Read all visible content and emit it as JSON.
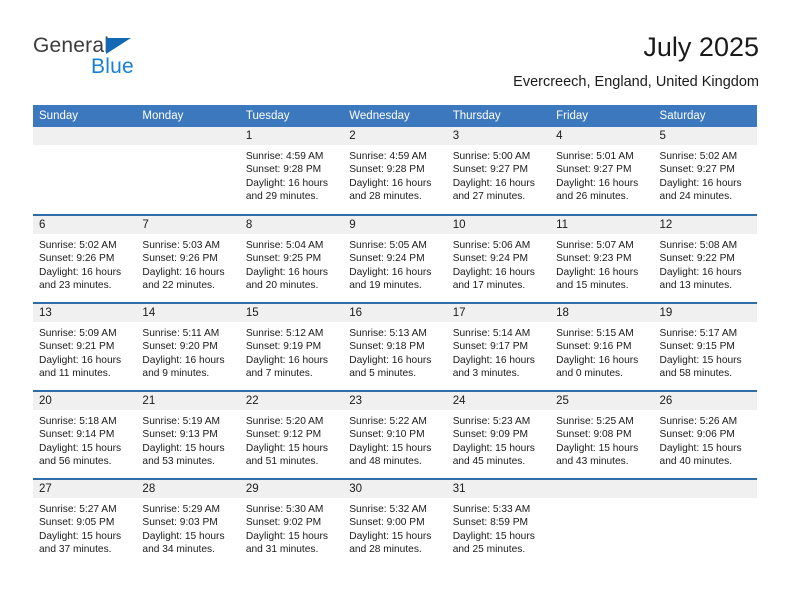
{
  "brand": {
    "name_top": "General",
    "name_bottom": "Blue",
    "triangle_color": "#1268b3",
    "blue_text_color": "#1a7fd4"
  },
  "header": {
    "title": "July 2025",
    "subtitle": "Evercreech, England, United Kingdom"
  },
  "colors": {
    "header_row_bg": "#3b78bd",
    "header_row_text": "#ffffff",
    "row_separator": "#2e6da8",
    "daynum_strip_bg": "#f0f0f0",
    "body_text": "#1a1a1a"
  },
  "weekday_headers": [
    "Sunday",
    "Monday",
    "Tuesday",
    "Wednesday",
    "Thursday",
    "Friday",
    "Saturday"
  ],
  "labels": {
    "sunrise_prefix": "Sunrise:",
    "sunset_prefix": "Sunset:",
    "daylight_prefix": "Daylight:"
  },
  "weeks": [
    [
      {
        "day": "",
        "sunrise": "",
        "sunset": "",
        "daylight_line1": "",
        "daylight_line2": ""
      },
      {
        "day": "",
        "sunrise": "",
        "sunset": "",
        "daylight_line1": "",
        "daylight_line2": ""
      },
      {
        "day": "1",
        "sunrise": "Sunrise: 4:59 AM",
        "sunset": "Sunset: 9:28 PM",
        "daylight_line1": "Daylight: 16 hours",
        "daylight_line2": "and 29 minutes."
      },
      {
        "day": "2",
        "sunrise": "Sunrise: 4:59 AM",
        "sunset": "Sunset: 9:28 PM",
        "daylight_line1": "Daylight: 16 hours",
        "daylight_line2": "and 28 minutes."
      },
      {
        "day": "3",
        "sunrise": "Sunrise: 5:00 AM",
        "sunset": "Sunset: 9:27 PM",
        "daylight_line1": "Daylight: 16 hours",
        "daylight_line2": "and 27 minutes."
      },
      {
        "day": "4",
        "sunrise": "Sunrise: 5:01 AM",
        "sunset": "Sunset: 9:27 PM",
        "daylight_line1": "Daylight: 16 hours",
        "daylight_line2": "and 26 minutes."
      },
      {
        "day": "5",
        "sunrise": "Sunrise: 5:02 AM",
        "sunset": "Sunset: 9:27 PM",
        "daylight_line1": "Daylight: 16 hours",
        "daylight_line2": "and 24 minutes."
      }
    ],
    [
      {
        "day": "6",
        "sunrise": "Sunrise: 5:02 AM",
        "sunset": "Sunset: 9:26 PM",
        "daylight_line1": "Daylight: 16 hours",
        "daylight_line2": "and 23 minutes."
      },
      {
        "day": "7",
        "sunrise": "Sunrise: 5:03 AM",
        "sunset": "Sunset: 9:26 PM",
        "daylight_line1": "Daylight: 16 hours",
        "daylight_line2": "and 22 minutes."
      },
      {
        "day": "8",
        "sunrise": "Sunrise: 5:04 AM",
        "sunset": "Sunset: 9:25 PM",
        "daylight_line1": "Daylight: 16 hours",
        "daylight_line2": "and 20 minutes."
      },
      {
        "day": "9",
        "sunrise": "Sunrise: 5:05 AM",
        "sunset": "Sunset: 9:24 PM",
        "daylight_line1": "Daylight: 16 hours",
        "daylight_line2": "and 19 minutes."
      },
      {
        "day": "10",
        "sunrise": "Sunrise: 5:06 AM",
        "sunset": "Sunset: 9:24 PM",
        "daylight_line1": "Daylight: 16 hours",
        "daylight_line2": "and 17 minutes."
      },
      {
        "day": "11",
        "sunrise": "Sunrise: 5:07 AM",
        "sunset": "Sunset: 9:23 PM",
        "daylight_line1": "Daylight: 16 hours",
        "daylight_line2": "and 15 minutes."
      },
      {
        "day": "12",
        "sunrise": "Sunrise: 5:08 AM",
        "sunset": "Sunset: 9:22 PM",
        "daylight_line1": "Daylight: 16 hours",
        "daylight_line2": "and 13 minutes."
      }
    ],
    [
      {
        "day": "13",
        "sunrise": "Sunrise: 5:09 AM",
        "sunset": "Sunset: 9:21 PM",
        "daylight_line1": "Daylight: 16 hours",
        "daylight_line2": "and 11 minutes."
      },
      {
        "day": "14",
        "sunrise": "Sunrise: 5:11 AM",
        "sunset": "Sunset: 9:20 PM",
        "daylight_line1": "Daylight: 16 hours",
        "daylight_line2": "and 9 minutes."
      },
      {
        "day": "15",
        "sunrise": "Sunrise: 5:12 AM",
        "sunset": "Sunset: 9:19 PM",
        "daylight_line1": "Daylight: 16 hours",
        "daylight_line2": "and 7 minutes."
      },
      {
        "day": "16",
        "sunrise": "Sunrise: 5:13 AM",
        "sunset": "Sunset: 9:18 PM",
        "daylight_line1": "Daylight: 16 hours",
        "daylight_line2": "and 5 minutes."
      },
      {
        "day": "17",
        "sunrise": "Sunrise: 5:14 AM",
        "sunset": "Sunset: 9:17 PM",
        "daylight_line1": "Daylight: 16 hours",
        "daylight_line2": "and 3 minutes."
      },
      {
        "day": "18",
        "sunrise": "Sunrise: 5:15 AM",
        "sunset": "Sunset: 9:16 PM",
        "daylight_line1": "Daylight: 16 hours",
        "daylight_line2": "and 0 minutes."
      },
      {
        "day": "19",
        "sunrise": "Sunrise: 5:17 AM",
        "sunset": "Sunset: 9:15 PM",
        "daylight_line1": "Daylight: 15 hours",
        "daylight_line2": "and 58 minutes."
      }
    ],
    [
      {
        "day": "20",
        "sunrise": "Sunrise: 5:18 AM",
        "sunset": "Sunset: 9:14 PM",
        "daylight_line1": "Daylight: 15 hours",
        "daylight_line2": "and 56 minutes."
      },
      {
        "day": "21",
        "sunrise": "Sunrise: 5:19 AM",
        "sunset": "Sunset: 9:13 PM",
        "daylight_line1": "Daylight: 15 hours",
        "daylight_line2": "and 53 minutes."
      },
      {
        "day": "22",
        "sunrise": "Sunrise: 5:20 AM",
        "sunset": "Sunset: 9:12 PM",
        "daylight_line1": "Daylight: 15 hours",
        "daylight_line2": "and 51 minutes."
      },
      {
        "day": "23",
        "sunrise": "Sunrise: 5:22 AM",
        "sunset": "Sunset: 9:10 PM",
        "daylight_line1": "Daylight: 15 hours",
        "daylight_line2": "and 48 minutes."
      },
      {
        "day": "24",
        "sunrise": "Sunrise: 5:23 AM",
        "sunset": "Sunset: 9:09 PM",
        "daylight_line1": "Daylight: 15 hours",
        "daylight_line2": "and 45 minutes."
      },
      {
        "day": "25",
        "sunrise": "Sunrise: 5:25 AM",
        "sunset": "Sunset: 9:08 PM",
        "daylight_line1": "Daylight: 15 hours",
        "daylight_line2": "and 43 minutes."
      },
      {
        "day": "26",
        "sunrise": "Sunrise: 5:26 AM",
        "sunset": "Sunset: 9:06 PM",
        "daylight_line1": "Daylight: 15 hours",
        "daylight_line2": "and 40 minutes."
      }
    ],
    [
      {
        "day": "27",
        "sunrise": "Sunrise: 5:27 AM",
        "sunset": "Sunset: 9:05 PM",
        "daylight_line1": "Daylight: 15 hours",
        "daylight_line2": "and 37 minutes."
      },
      {
        "day": "28",
        "sunrise": "Sunrise: 5:29 AM",
        "sunset": "Sunset: 9:03 PM",
        "daylight_line1": "Daylight: 15 hours",
        "daylight_line2": "and 34 minutes."
      },
      {
        "day": "29",
        "sunrise": "Sunrise: 5:30 AM",
        "sunset": "Sunset: 9:02 PM",
        "daylight_line1": "Daylight: 15 hours",
        "daylight_line2": "and 31 minutes."
      },
      {
        "day": "30",
        "sunrise": "Sunrise: 5:32 AM",
        "sunset": "Sunset: 9:00 PM",
        "daylight_line1": "Daylight: 15 hours",
        "daylight_line2": "and 28 minutes."
      },
      {
        "day": "31",
        "sunrise": "Sunrise: 5:33 AM",
        "sunset": "Sunset: 8:59 PM",
        "daylight_line1": "Daylight: 15 hours",
        "daylight_line2": "and 25 minutes."
      },
      {
        "day": "",
        "sunrise": "",
        "sunset": "",
        "daylight_line1": "",
        "daylight_line2": ""
      },
      {
        "day": "",
        "sunrise": "",
        "sunset": "",
        "daylight_line1": "",
        "daylight_line2": ""
      }
    ]
  ]
}
